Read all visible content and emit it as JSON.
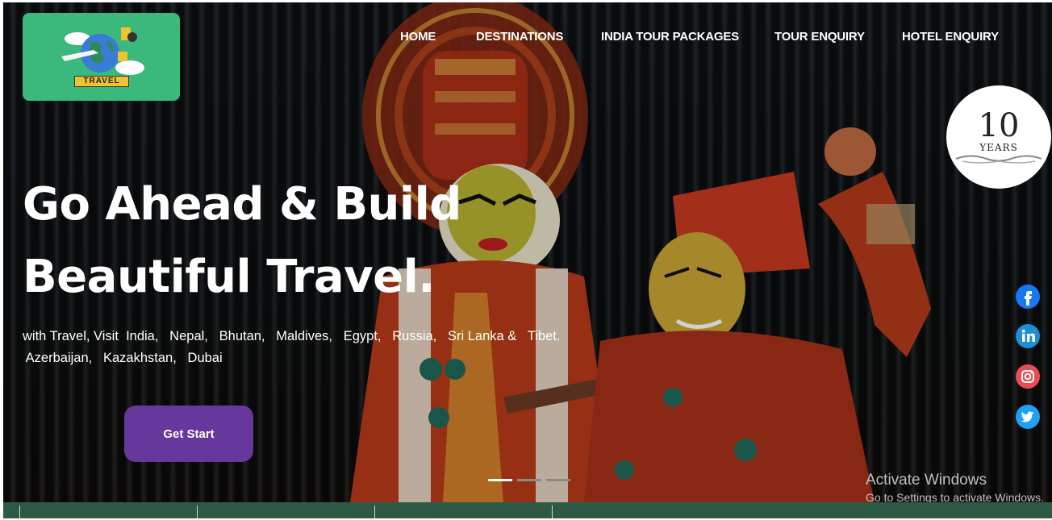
{
  "nav": {
    "items": [
      "HOME",
      "DESTINATIONS",
      "INDIA TOUR PACKAGES",
      "TOUR ENQUIRY",
      "HOTEL ENQUIRY"
    ]
  },
  "logo": {
    "text": "TRAVEL"
  },
  "badge": {
    "number": "10",
    "word": "YEARS"
  },
  "hero": {
    "headline_line1": "Go Ahead & Build",
    "headline_line2": "Beautiful Travel.",
    "sub_line1": "with Travel, Visit  India,   Nepal,   Bhutan,   Maldives,   Egypt,   Russia,   Sri Lanka &   Tibet.",
    "sub_line2": " Azerbaijan,   Kazakhstan,   Dubai",
    "cta_label": "Get Start"
  },
  "slider": {
    "slides": 3,
    "active_index": 0
  },
  "social": [
    "facebook-icon",
    "linkedin-icon",
    "instagram-icon",
    "twitter-icon"
  ],
  "watermark": {
    "title": "Activate Windows",
    "subtitle": "Go to Settings to activate Windows."
  },
  "colors": {
    "logo_bg": "#3bb87c",
    "cta_bg": "#66379c",
    "bottom_bar": "#2e5a45"
  }
}
